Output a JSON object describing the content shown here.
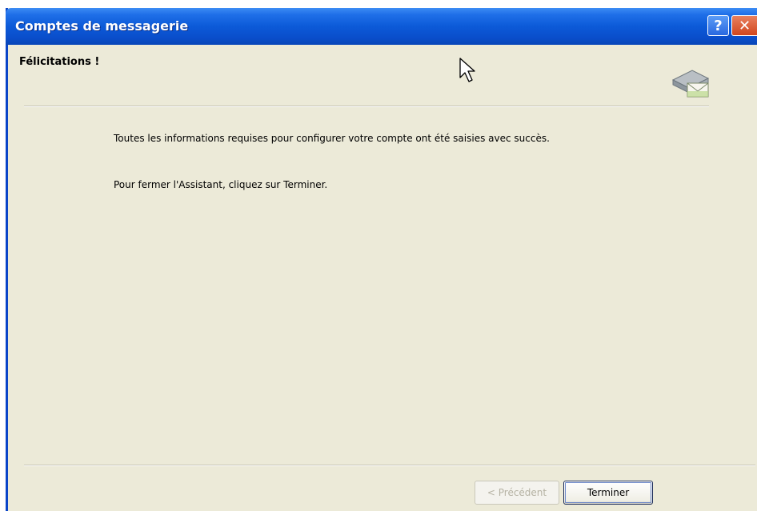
{
  "window": {
    "title": "Comptes de messagerie",
    "help_label": "?",
    "close_label": "✕"
  },
  "header": {
    "title": "Félicitations !",
    "icon": "mail-drive-icon"
  },
  "content": {
    "line1": "Toutes les informations requises pour configurer votre compte ont été saisies avec succès.",
    "line2": "Pour fermer l'Assistant, cliquez sur Terminer."
  },
  "buttons": {
    "prev_label": "< Précédent",
    "finish_label": "Terminer"
  },
  "colors": {
    "titlebar": "#0a4ecb",
    "dialog_bg": "#ecead8"
  }
}
